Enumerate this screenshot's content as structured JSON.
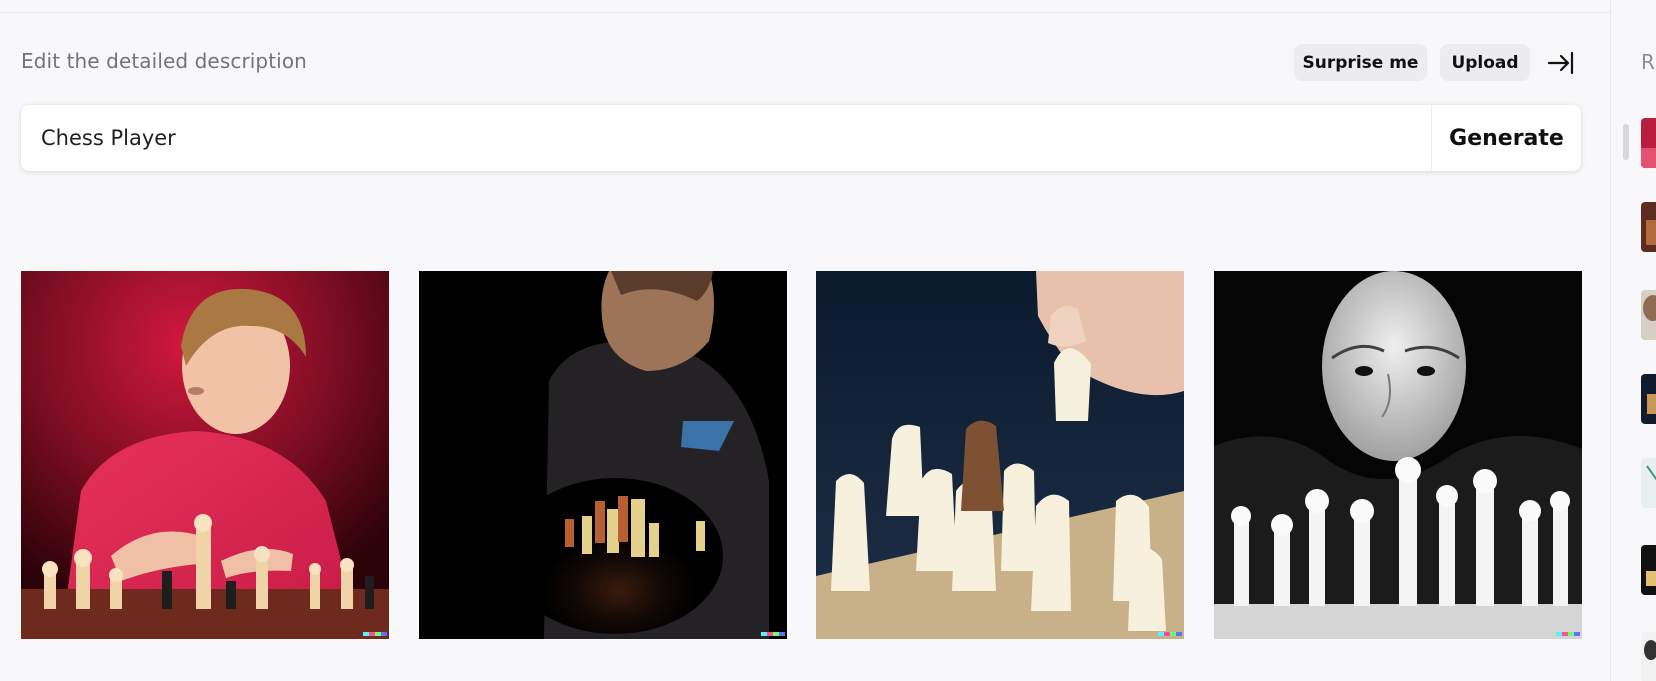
{
  "header": {
    "prompt_label": "Edit the detailed description",
    "surprise_label": "Surprise me",
    "upload_label": "Upload",
    "collapse_icon": "collapse-right-icon"
  },
  "prompt": {
    "value": "Chess Player",
    "generate_label": "Generate"
  },
  "gallery": {
    "images": [
      {
        "name": "chess-player-red-shirt-image"
      },
      {
        "name": "chess-player-black-shirt-image"
      },
      {
        "name": "chess-hand-white-pieces-image"
      },
      {
        "name": "chess-player-black-white-portrait-image"
      }
    ]
  },
  "sidebar": {
    "title": "R",
    "thumbnails": [
      "recent-thumbnail-1",
      "recent-thumbnail-2",
      "recent-thumbnail-3",
      "recent-thumbnail-4",
      "recent-thumbnail-5",
      "recent-thumbnail-6",
      "recent-thumbnail-7"
    ]
  },
  "colors": {
    "background": "#f8f8fa",
    "chip_background": "#ececf0",
    "text_primary": "#111111",
    "text_muted": "#737379"
  }
}
